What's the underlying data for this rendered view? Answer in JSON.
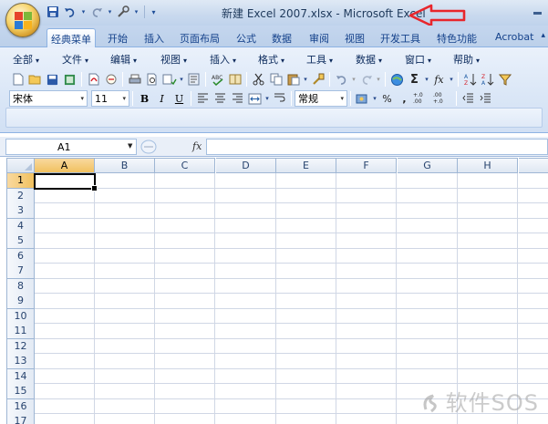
{
  "window": {
    "title": "新建 Excel 2007.xlsx - Microsoft Excel"
  },
  "quick_access": [
    "save-icon",
    "undo-icon",
    "redo-icon",
    "tools-icon",
    "customize-icon"
  ],
  "tabs": [
    {
      "label": "经典菜单",
      "active": true
    },
    {
      "label": "开始"
    },
    {
      "label": "插入"
    },
    {
      "label": "页面布局"
    },
    {
      "label": "公式"
    },
    {
      "label": "数据"
    },
    {
      "label": "审阅"
    },
    {
      "label": "视图"
    },
    {
      "label": "开发工具"
    },
    {
      "label": "特色功能"
    },
    {
      "label": "Acrobat"
    }
  ],
  "menus": [
    {
      "label": "全部"
    },
    {
      "label": "文件"
    },
    {
      "label": "编辑"
    },
    {
      "label": "视图"
    },
    {
      "label": "插入"
    },
    {
      "label": "格式"
    },
    {
      "label": "工具"
    },
    {
      "label": "数据"
    },
    {
      "label": "窗口"
    },
    {
      "label": "帮助"
    }
  ],
  "format_bar": {
    "font": "宋体",
    "size": "11",
    "bold": "B",
    "italic": "I",
    "underline": "U",
    "number_format": "常规",
    "percent": "%",
    "comma": ",",
    "inc_decimal": "+.0 .00",
    "dec_decimal": ".00 +.0"
  },
  "standard_bar": {
    "sum": "Σ",
    "fx": "fx"
  },
  "formula_bar": {
    "name_box": "A1",
    "fx": "fx",
    "value": ""
  },
  "sheet": {
    "columns": [
      "A",
      "B",
      "C",
      "D",
      "E",
      "F",
      "G",
      "H"
    ],
    "rows": [
      "1",
      "2",
      "3",
      "4",
      "5",
      "6",
      "7",
      "8",
      "9",
      "10",
      "11",
      "12",
      "13",
      "14",
      "15",
      "16",
      "17"
    ],
    "active_cell": "A1"
  },
  "watermark": "软件SOS",
  "colors": {
    "annotation_arrow": "#e8262c",
    "selection_header": "#f4c56c"
  }
}
